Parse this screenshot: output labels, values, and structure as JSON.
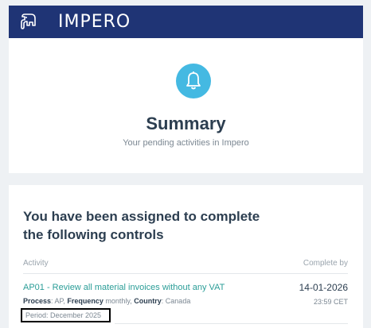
{
  "brand": {
    "name": "IMPERO",
    "logo_icon": "elephant-icon",
    "bar_color": "#1f3475"
  },
  "summary": {
    "icon": "bell-icon",
    "icon_color": "#44b9e2",
    "title": "Summary",
    "subtitle": "Your pending activities in Impero"
  },
  "assignments": {
    "heading": "You have been assigned to complete the following controls",
    "columns": {
      "activity": "Activity",
      "complete_by": "Complete by"
    },
    "items": [
      {
        "title": "AP01 - Review all material invoices without any VAT",
        "process_label": "Process",
        "process_value": ": AP,",
        "frequency_label": "Frequency",
        "frequency_value": " monthly,",
        "country_label": "Country",
        "country_value": ": Canada",
        "period": "Period: December 2025",
        "due_date": "14-01-2026",
        "due_time": "23:59 CET"
      }
    ]
  },
  "colors": {
    "link": "#2a9d97",
    "heading": "#2c3e50",
    "muted": "#7b8792"
  }
}
